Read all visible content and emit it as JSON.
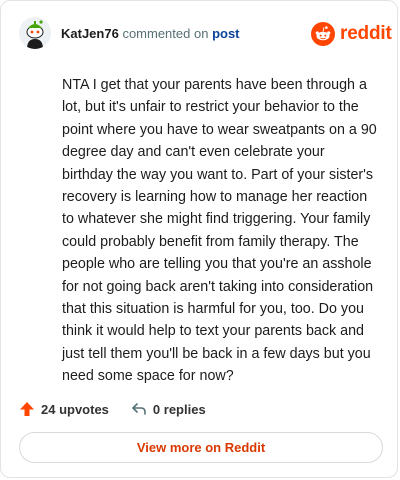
{
  "header": {
    "username": "KatJen76",
    "action_text": "commented on",
    "post_link": "post",
    "logo_text": "reddit"
  },
  "comment": {
    "text": "NTA I get that your parents have been through a lot, but it's unfair to restrict your behavior to the point where you have to wear sweatpants on a 90 degree day and can't even celebrate your birthday the way you want to. Part of your sister's recovery is learning how to manage her reaction to whatever she might find triggering. Your family could probably benefit from family therapy. The people who are telling you that you're an asshole for not going back aren't taking into consideration that this situation is harmful for you, too. Do you think it would help to text your parents back and just tell them you'll be back in a few days but you need some space for now?"
  },
  "footer": {
    "upvotes": "24 upvotes",
    "replies": "0 replies"
  },
  "cta": {
    "label": "View more on Reddit"
  },
  "colors": {
    "brand": "#ff4500",
    "link": "#0a449b",
    "cta_text": "#d93900"
  },
  "icons": {
    "avatar": "snoo-avatar-icon",
    "logo": "reddit-logo-icon",
    "upvote": "upvote-arrow-icon",
    "reply": "reply-arrow-icon"
  }
}
